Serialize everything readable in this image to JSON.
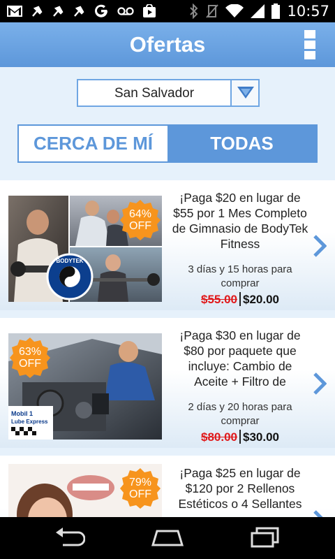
{
  "status_bar": {
    "time": "10:57",
    "icons": [
      "gmail-icon",
      "pin-icon",
      "pin-icon",
      "pin-icon",
      "google-icon",
      "voicemail-icon",
      "play-store-icon",
      "bluetooth-icon",
      "vibrate-icon",
      "wifi-icon",
      "signal-icon",
      "battery-icon"
    ]
  },
  "header": {
    "title": "Ofertas",
    "menu_icon": "overflow-menu-icon"
  },
  "city_select": {
    "value": "San Salvador"
  },
  "tabs": [
    {
      "label": "CERCA DE MÍ",
      "active": false
    },
    {
      "label": "TODAS",
      "active": true
    }
  ],
  "deals": [
    {
      "discount": "64%",
      "discount_label": "OFF",
      "title": "¡Paga $20 en lugar de $55 por 1 Mes Completo de Gimnasio de BodyTek Fitness",
      "time_left": "3 días y 15 horas para comprar",
      "old_price": "$55.00",
      "new_price": "$20.00",
      "image_text": "BODYTEK"
    },
    {
      "discount": "63%",
      "discount_label": "OFF",
      "title": "¡Paga $30 en lugar de $80 por paquete que incluye: Cambio de Aceite + Filtro de",
      "time_left": "2 días y 20 horas para comprar",
      "old_price": "$80.00",
      "new_price": "$30.00",
      "image_text": "Mobil 1 Lube Express"
    },
    {
      "discount": "79%",
      "discount_label": "OFF",
      "title": "¡Paga $25 en lugar de $120 por 2 Rellenos Estéticos o 4 Sellantes",
      "time_left": "",
      "old_price": "",
      "new_price": ""
    }
  ],
  "colors": {
    "accent": "#5d97da",
    "badge": "#f7941d",
    "old_price": "#e0191b",
    "background": "#e6f1fb"
  }
}
